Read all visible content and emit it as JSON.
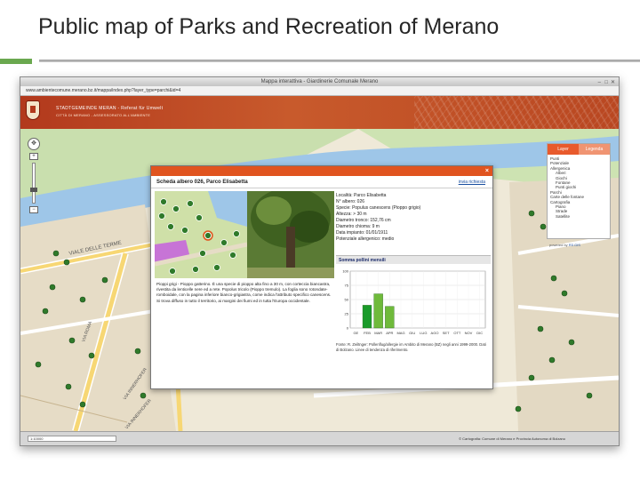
{
  "slide": {
    "title": "Public map of Parks and Recreation of Merano"
  },
  "window": {
    "title": "Mappa interattiva - Giardinerie Comunale Merano",
    "url": "www.ambientecomune.merano.bz.it/mappa/index.php?layer_type=parchi&id=4",
    "controls": {
      "min": "–",
      "max": "□",
      "close": "✕"
    }
  },
  "banner": {
    "line1": "STADTGEMEINDE MERAN - Referat für Umwelt",
    "line2": "CITTÀ DI MERANO - ASSESSORATO ALL'AMBIENTE"
  },
  "map": {
    "street_labels": [
      "VIALE DELLE TERME",
      "VIA ROMA",
      "VIA INNERHOFER",
      "VIA INNERHOFER"
    ],
    "zoom": {
      "pan_glyph": "✥",
      "zoom_in": "+",
      "zoom_out": "−"
    }
  },
  "layers_panel": {
    "tab_layer": "Layer",
    "tab_legend": "Legenda",
    "items": [
      {
        "label": "Punti",
        "sub": false
      },
      {
        "label": "Potenziale",
        "sub": false
      },
      {
        "label": "Allergenica",
        "sub": false
      },
      {
        "label": "Alberi",
        "sub": true
      },
      {
        "label": "Giochi",
        "sub": true
      },
      {
        "label": "Fontane",
        "sub": true
      },
      {
        "label": "Punti giochi",
        "sub": true
      },
      {
        "label": "Parchi",
        "sub": false
      },
      {
        "label": "Carte delle fontane",
        "sub": false
      },
      {
        "label": "Cartografia",
        "sub": false
      },
      {
        "label": "Piano",
        "sub": true
      },
      {
        "label": "Strade",
        "sub": true
      },
      {
        "label": "Satellite",
        "sub": true
      }
    ],
    "powered": "powered by",
    "powered_brand": "R3 GIS"
  },
  "popup": {
    "close": "×",
    "title": "Scheda albero 026, Parco Elisabetta",
    "send_link": "invia richiesta",
    "attributes": [
      "Località: Parco Elisabetta",
      "N° albero: 026",
      "Specie: Populus canescens (Pioppo grigio)",
      "Altezza: > 30 m",
      "Diametro tronco: 152,76 cm",
      "Diametro chioma: 9 m",
      "Data impianto: 01/01/1911",
      "Potenziale allergenico: medio"
    ],
    "pollen_header": "Somma pollini mensili",
    "description": "Pioppi grigi - Pioppo gatterino. È una specie di pioppo alta fino a 30 m, con corteccia biancastra, rivestita da lenticelle nere ed a rete. Popolus tricolo (Pioppo tremulo). La foglia sono rotondate-romboidale, con la pagina inferiore bianco-grigiastra, come indica l'attributo specifico canescens. Si trova diffuso in tutto il territorio, ai margini dei fiumi ed in tutta l'Europa occidentale.",
    "source": "Fonte: R. Zeiltnger: Pollenflug/allergie im Ambito di Merano (BZ) negli anni 1999-2000. Dati di Bolzano. Linee di tendenza di riferimento."
  },
  "statusbar": {
    "scale_text": "1:10000",
    "copyright": "© Cartografia: Comune di Merano e Provincia Autonoma di Bolzano"
  },
  "chart_data": {
    "type": "bar",
    "title": "Somma pollini mensili",
    "categories": [
      "GE",
      "FEB",
      "MAR",
      "APR",
      "MAG",
      "GIU",
      "LUG",
      "AGO",
      "SET",
      "OTT",
      "NOV",
      "DIC"
    ],
    "values": [
      0,
      40,
      60,
      38,
      0,
      0,
      0,
      0,
      0,
      0,
      0,
      0
    ],
    "ylim": [
      0,
      100
    ],
    "yticks": [
      0,
      25,
      50,
      75,
      100
    ],
    "ytick_labels": [
      "0",
      "25",
      "50",
      "75",
      "100"
    ],
    "bar_colors": [
      "#6fba3b",
      "#1a9b2a",
      "#6fba3b",
      "#6fba3b",
      "#6fba3b",
      "#6fba3b",
      "#6fba3b",
      "#6fba3b",
      "#6fba3b",
      "#6fba3b",
      "#6fba3b",
      "#6fba3b"
    ],
    "grid": true
  }
}
